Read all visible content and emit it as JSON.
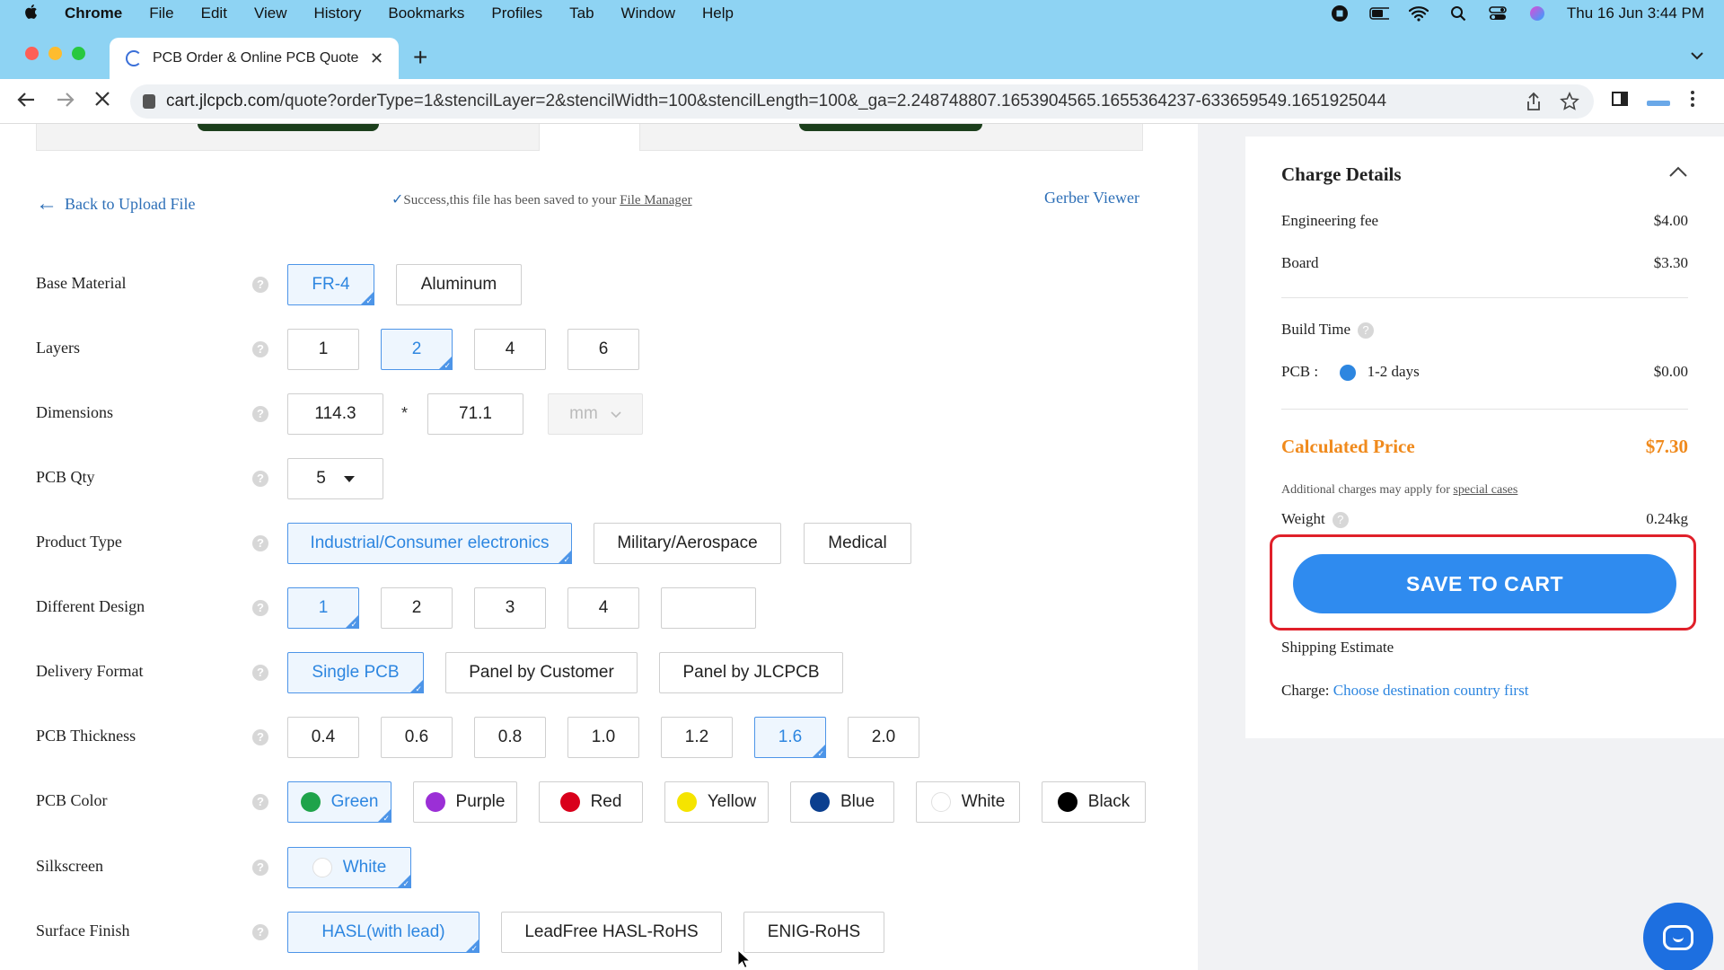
{
  "menubar": {
    "apple": "",
    "items": [
      "Chrome",
      "File",
      "Edit",
      "View",
      "History",
      "Bookmarks",
      "Profiles",
      "Tab",
      "Window",
      "Help"
    ],
    "clock": "Thu 16 Jun  3:44 PM"
  },
  "browser": {
    "tab_title": "PCB Order & Online PCB Quote",
    "tab_close": "✕",
    "new_tab": "+",
    "url_host": "cart.jlcpcb.com",
    "url_path": "/quote?orderType=1&stencilLayer=2&stencilWidth=100&stencilLength=100&_ga=2.248748807.1653904565.1655364237-633659549.1651925044"
  },
  "page": {
    "back_link": "Back to Upload File",
    "success_text": "Success,this file has been saved to your ",
    "file_manager": "File Manager",
    "gerber_viewer": "Gerber Viewer",
    "help_glyph": "?"
  },
  "form": {
    "base_material": {
      "label": "Base Material",
      "options": [
        "FR-4",
        "Aluminum"
      ],
      "selected": "FR-4"
    },
    "layers": {
      "label": "Layers",
      "options": [
        "1",
        "2",
        "4",
        "6"
      ],
      "selected": "2"
    },
    "dimensions": {
      "label": "Dimensions",
      "width": "114.3",
      "times": "*",
      "height": "71.1",
      "unit": "mm"
    },
    "pcb_qty": {
      "label": "PCB Qty",
      "value": "5"
    },
    "product_type": {
      "label": "Product Type",
      "options": [
        "Industrial/Consumer electronics",
        "Military/Aerospace",
        "Medical"
      ],
      "selected": "Industrial/Consumer electronics"
    },
    "different_design": {
      "label": "Different Design",
      "options": [
        "1",
        "2",
        "3",
        "4",
        ""
      ],
      "selected": "1"
    },
    "delivery_format": {
      "label": "Delivery Format",
      "options": [
        "Single PCB",
        "Panel by Customer",
        "Panel by JLCPCB"
      ],
      "selected": "Single PCB"
    },
    "pcb_thickness": {
      "label": "PCB Thickness",
      "options": [
        "0.4",
        "0.6",
        "0.8",
        "1.0",
        "1.2",
        "1.6",
        "2.0"
      ],
      "selected": "1.6"
    },
    "pcb_color": {
      "label": "PCB Color",
      "options": [
        {
          "name": "Green",
          "color": "#1fa34a"
        },
        {
          "name": "Purple",
          "color": "#9b2fd6"
        },
        {
          "name": "Red",
          "color": "#d9001b"
        },
        {
          "name": "Yellow",
          "color": "#f5e400"
        },
        {
          "name": "Blue",
          "color": "#0b3f8f"
        },
        {
          "name": "White",
          "color": "#ffffff"
        },
        {
          "name": "Black",
          "color": "#000000"
        }
      ],
      "selected": "Green"
    },
    "silkscreen": {
      "label": "Silkscreen",
      "options": [
        {
          "name": "White",
          "color": "#ffffff"
        }
      ],
      "selected": "White"
    },
    "surface_finish": {
      "label": "Surface Finish",
      "options": [
        "HASL(with lead)",
        "LeadFree HASL-RoHS",
        "ENIG-RoHS"
      ],
      "selected": "HASL(with lead)"
    }
  },
  "charges": {
    "title": "Charge Details",
    "engineering_fee_label": "Engineering fee",
    "engineering_fee": "$4.00",
    "board_label": "Board",
    "board": "$3.30",
    "build_time_label": "Build Time",
    "pcb_label": "PCB :",
    "pcb_days": "1-2 days",
    "pcb_build_cost": "$0.00",
    "calculated_label": "Calculated Price",
    "calculated_price": "$7.30",
    "additional_text": "Additional charges may apply for ",
    "special_cases": "special cases",
    "weight_label": "Weight",
    "weight": "0.24kg",
    "save_to_cart": "SAVE TO CART",
    "shipping_estimate": "Shipping Estimate",
    "charge_label": "Charge: ",
    "charge_link": "Choose destination country first"
  },
  "colors": {
    "accent": "#2f8bef",
    "price": "#f08a1c",
    "highlight": "#e0202a"
  }
}
